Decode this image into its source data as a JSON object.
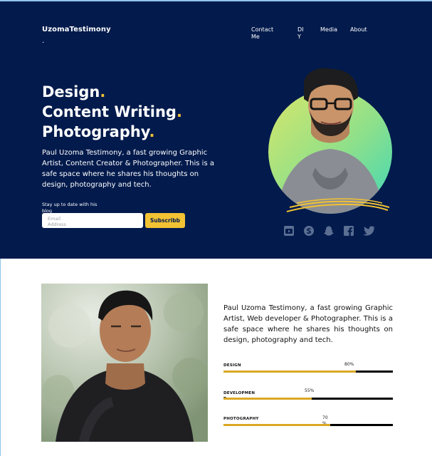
{
  "brand": {
    "name": "UzomaTestimony",
    "dot": "."
  },
  "nav": {
    "contact": "Contact Me",
    "diy": "DI Y",
    "media": "Media",
    "about": "About"
  },
  "hero": {
    "line1": "Design",
    "line2": "Content Writing",
    "line3": "Photography",
    "dot": ".",
    "intro": "Paul Uzoma Testimony, a fast growing Graphic Artist, Content Creator & Photographer. This is a safe space where he shares his thoughts on design, photography and tech.",
    "subscribe_label": "Stay up to date with his blog",
    "email_placeholder": "Email Address",
    "subscribe_button": "Subscribb"
  },
  "socials": [
    "youtube-icon",
    "skype-icon",
    "snapchat-icon",
    "facebook-icon",
    "twitter-icon"
  ],
  "colors": {
    "navy": "#021a4c",
    "accent": "#f2c233",
    "bar_fill": "#dba825"
  },
  "about": {
    "bio": "Paul Uzoma Testimony, a fast growing Graphic Artist, Web developer & Photographer. This is a safe space where he shares his thoughts on design, photography and tech."
  },
  "skills": [
    {
      "name": "DESIGN",
      "percent_label": "80%",
      "value": 0.78
    },
    {
      "name": "DEVELOPMEN T",
      "percent_label": "55%",
      "value": 0.52
    },
    {
      "name": "PHOTOGRAPHY",
      "percent_label": "70 %",
      "value": 0.63
    }
  ]
}
